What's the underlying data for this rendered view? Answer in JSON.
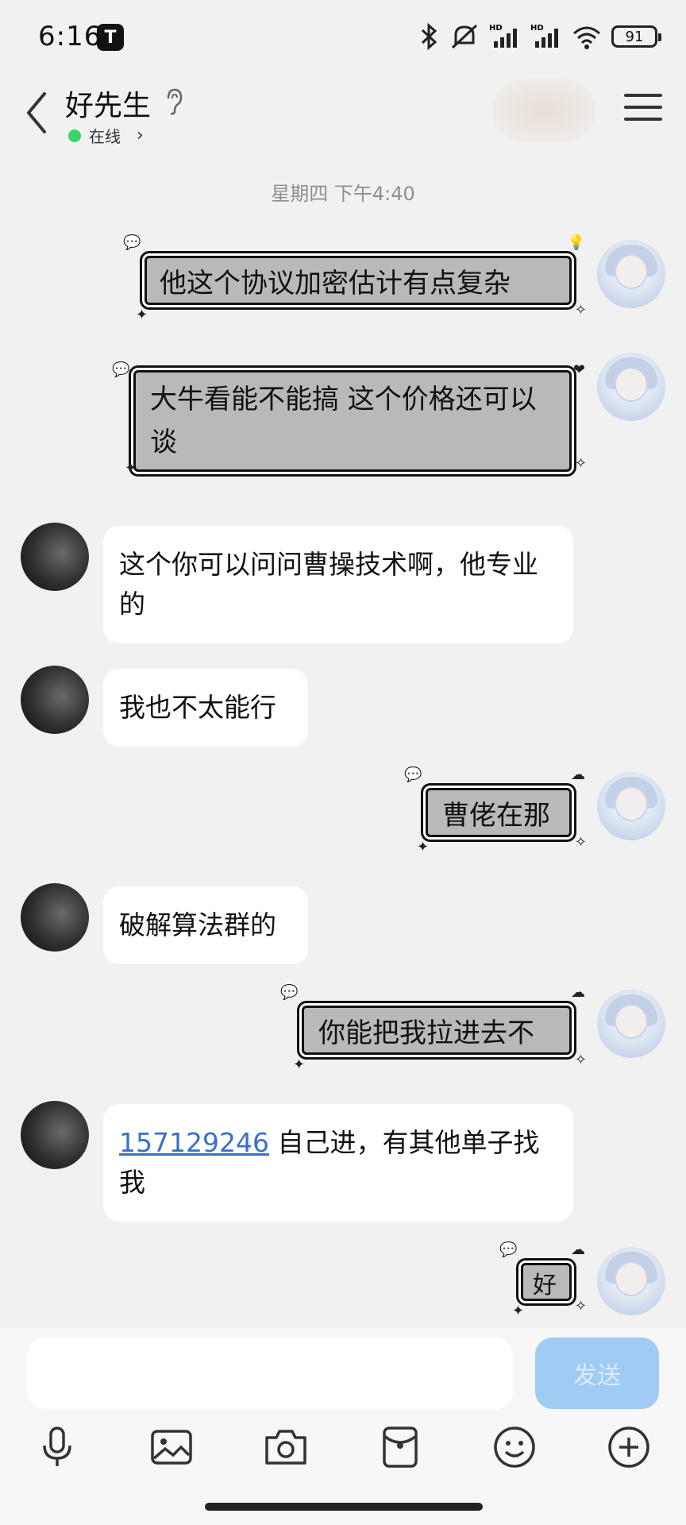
{
  "status_bar": {
    "time": "6:16",
    "tiktok_icon": "T",
    "battery": "91",
    "icons": [
      "bluetooth-icon",
      "mute-icon",
      "signal-hd-icon",
      "signal-hd-icon",
      "wifi-icon",
      "battery-icon"
    ]
  },
  "header": {
    "contact_name": "好先生",
    "status": "在线",
    "status_color": "#3ad36a"
  },
  "chat": {
    "timestamp": "星期四 下午4:40",
    "messages": [
      {
        "side": "right",
        "type": "sticker-text",
        "text": "他这个协议加密估计有点复杂"
      },
      {
        "side": "right",
        "type": "sticker-text",
        "text": "大牛看能不能搞 这个价格还可以谈"
      },
      {
        "side": "left",
        "type": "text",
        "text": "这个你可以问问曹操技术啊，他专业的"
      },
      {
        "side": "left",
        "type": "text",
        "text": "我也不太能行"
      },
      {
        "side": "right",
        "type": "sticker-text",
        "text": "曹佬在那"
      },
      {
        "side": "left",
        "type": "text",
        "text": "破解算法群的"
      },
      {
        "side": "right",
        "type": "sticker-text",
        "text": "你能把我拉进去不"
      },
      {
        "side": "left",
        "type": "text",
        "link": "157129246",
        "text": " 自己进，有其他单子找我"
      },
      {
        "side": "right",
        "type": "sticker-text",
        "text": "好"
      }
    ]
  },
  "input": {
    "placeholder": "",
    "send_label": "发送",
    "send_color": "#9fcbf5"
  },
  "toolbar": {
    "tools": [
      "microphone-icon",
      "image-icon",
      "camera-icon",
      "red-packet-icon",
      "emoji-icon",
      "plus-icon"
    ]
  }
}
